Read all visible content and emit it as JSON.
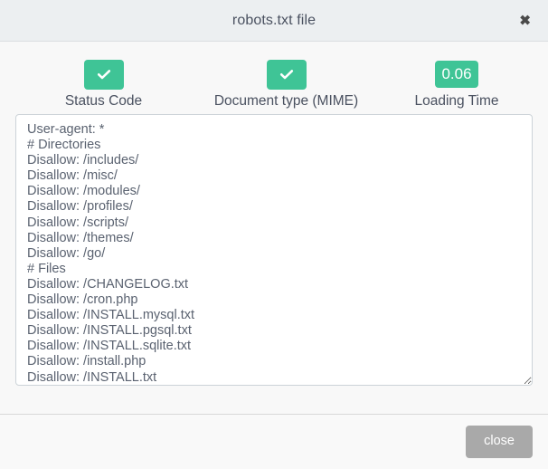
{
  "header": {
    "title": "robots.txt file",
    "close_icon": "close-x-icon",
    "close_icon_glyph": "✖"
  },
  "colors": {
    "accent_green": "#3fc496",
    "header_bg": "#eceff1",
    "body_bg": "#f8f8f8",
    "footer_bg": "#f9f9f9",
    "text": "#4a5160",
    "textarea_text": "#5a6270",
    "button_gray": "#a9a9a9"
  },
  "metrics": [
    {
      "label": "Status Code",
      "badge_type": "check",
      "badge_value": "",
      "icon": "check-icon",
      "status": "ok"
    },
    {
      "label": "Document type (MIME)",
      "badge_type": "check",
      "badge_value": "",
      "icon": "check-icon",
      "status": "ok"
    },
    {
      "label": "Loading Time",
      "badge_type": "value",
      "badge_value": "0.06",
      "icon": "",
      "status": "ok"
    }
  ],
  "file_view": {
    "content": "User-agent: *\n# Directories\nDisallow: /includes/\nDisallow: /misc/\nDisallow: /modules/\nDisallow: /profiles/\nDisallow: /scripts/\nDisallow: /themes/\nDisallow: /go/\n# Files\nDisallow: /CHANGELOG.txt\nDisallow: /cron.php\nDisallow: /INSTALL.mysql.txt\nDisallow: /INSTALL.pgsql.txt\nDisallow: /INSTALL.sqlite.txt\nDisallow: /install.php\nDisallow: /INSTALL.txt",
    "placeholder": ""
  },
  "footer": {
    "close_label": "close"
  }
}
